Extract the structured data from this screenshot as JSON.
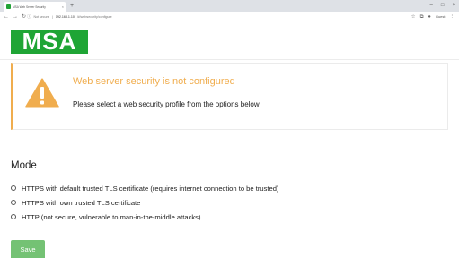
{
  "browser": {
    "tab_title": "MSA Web Server Security",
    "tab_close": "×",
    "new_tab": "+",
    "window_controls": [
      "–",
      "□",
      "×"
    ],
    "nav": {
      "back": "←",
      "forward": "→",
      "reload": "↻"
    },
    "address_prefix": "Not secure",
    "address_host": "192.168.1.10",
    "address_path": "/#/websecurity/configure",
    "account_label": "Guest"
  },
  "logo": {
    "text": "MSA",
    "color": "#1fa535"
  },
  "alert": {
    "title": "Web server security is not configured",
    "message": "Please select a web security profile from the options below.",
    "accent_color": "#f0ad4e",
    "icon": "warning-triangle-icon"
  },
  "mode": {
    "title": "Mode",
    "options": [
      {
        "label": "HTTPS with default trusted TLS certificate (requires internet connection to be trusted)",
        "selected": false
      },
      {
        "label": "HTTPS with own trusted TLS certificate",
        "selected": false
      },
      {
        "label": "HTTP (not secure, vulnerable to man-in-the-middle attacks)",
        "selected": false
      }
    ]
  },
  "actions": {
    "save_label": "Save",
    "save_color": "#5cb85c"
  }
}
